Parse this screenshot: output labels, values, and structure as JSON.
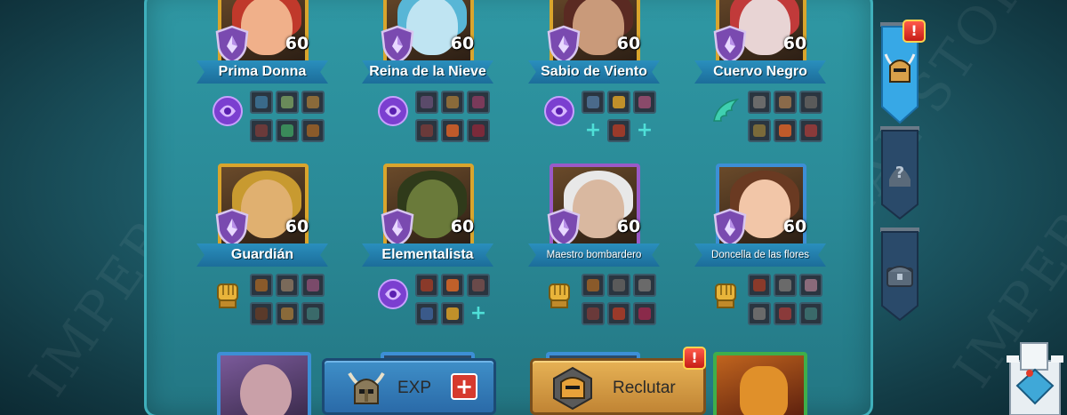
{
  "watermark": "IMPERIAL STORE",
  "heroes": [
    {
      "name": "Prima Donna",
      "level": "60",
      "frame": "gold",
      "skin": "#f0b08a",
      "hair": "#c0392b",
      "special": "purple-orb"
    },
    {
      "name": "Reina de la Nieve",
      "level": "60",
      "frame": "gold",
      "skin": "#bfe4f2",
      "hair": "#58b6d6",
      "special": "purple-orb"
    },
    {
      "name": "Sabio de Viento",
      "level": "60",
      "frame": "gold",
      "skin": "#c99a7a",
      "hair": "#5a2a22",
      "special": "purple-orb"
    },
    {
      "name": "Cuervo Negro",
      "level": "60",
      "frame": "gold",
      "skin": "#e8d4d4",
      "hair": "#c13a3a",
      "special": "green-wing"
    },
    {
      "name": "Guardián",
      "level": "60",
      "frame": "gold",
      "skin": "#e0b070",
      "hair": "#c89a30",
      "special": "gold-fist"
    },
    {
      "name": "Elementalista",
      "level": "60",
      "frame": "gold",
      "skin": "#6a7a3a",
      "hair": "#2f3a1a",
      "special": "purple-orb"
    },
    {
      "name": "Maestro bombardero",
      "level": "60",
      "frame": "purple",
      "skin": "#d9b8a0",
      "hair": "#e8e8e8",
      "special": "gold-fist"
    },
    {
      "name": "Doncella de las flores",
      "level": "60",
      "frame": "blue",
      "skin": "#f2c6a8",
      "hair": "#6a3a22",
      "special": "gold-fist"
    }
  ],
  "buttons": {
    "exp_label": "EXP",
    "recruit_label": "Reclutar"
  },
  "side_tabs": [
    "helmet-tab",
    "question-tab",
    "chest-tab"
  ]
}
